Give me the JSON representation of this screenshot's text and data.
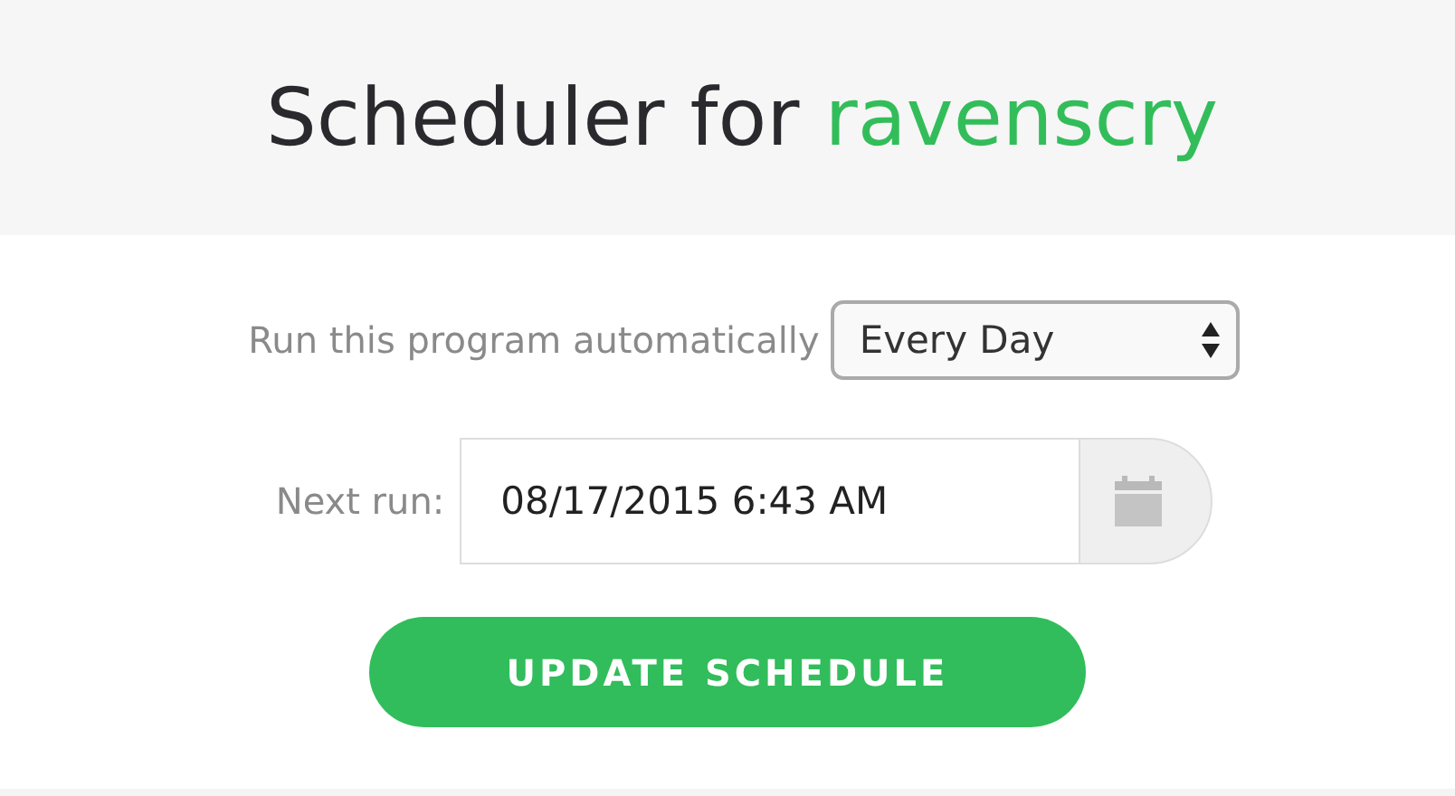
{
  "header": {
    "title_prefix": "Scheduler for",
    "program_name": "ravenscry"
  },
  "frequency": {
    "label": "Run this program automatically",
    "value": "Every Day"
  },
  "next_run": {
    "label": "Next run:",
    "value": "08/17/2015 6:43 AM"
  },
  "buttons": [
    "UPDATE SCHEDULE"
  ]
}
